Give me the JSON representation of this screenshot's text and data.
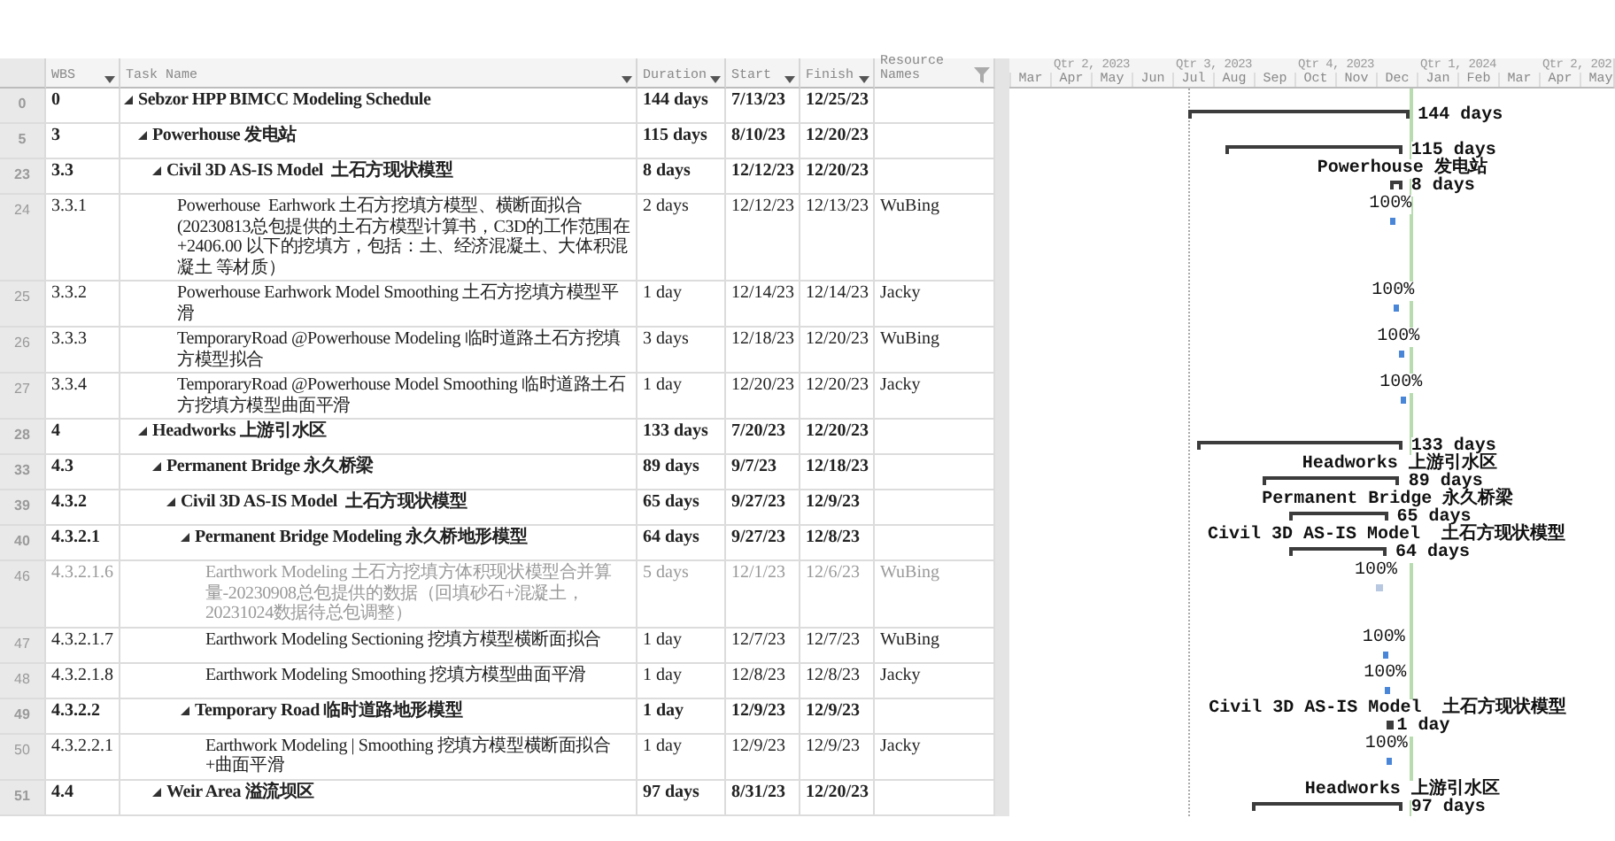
{
  "table": {
    "columns": [
      {
        "label": "WBS"
      },
      {
        "label": "Task Name"
      },
      {
        "label": "Duration"
      },
      {
        "label": "Start"
      },
      {
        "label": "Finish"
      },
      {
        "label": "Resource Names"
      }
    ],
    "rows": [
      {
        "id": "0",
        "wbs": "0",
        "name": "Sebzor HPP BIMCC Modeling Schedule",
        "duration": "144 days",
        "start": "7/13/23",
        "finish": "12/25/23",
        "kind": "summary",
        "expanded": true,
        "gantt": {
          "right": "144 days"
        },
        "children": [
          {
            "id": "5",
            "wbs": "3",
            "name": "Powerhouse 发电站",
            "duration": "115 days",
            "start": "8/10/23",
            "finish": "12/20/23",
            "kind": "summary",
            "expanded": true,
            "gantt": {
              "right": "115 days"
            },
            "children": [
              {
                "id": "23",
                "wbs": "3.3",
                "name": "Civil 3D AS-IS Model  土石方现状模型",
                "duration": "8 days",
                "start": "12/12/23",
                "finish": "12/20/23",
                "kind": "summary",
                "expanded": true,
                "gantt": {
                  "above": "Powerhouse 发电站",
                  "right": "8 days"
                },
                "children": [
                  {
                    "id": "24",
                    "wbs": "3.3.1",
                    "name": "Powerhouse  Earhwork 土石方挖填方模型、横断面拟合 (20230813总包提供的土石方模型计算书，C3D的工作范围在 +2406.00 以下的挖填方，包括：土、经济混凝土、大体积混凝土 等材质）",
                    "duration": "2 days",
                    "start": "12/12/23",
                    "finish": "12/13/23",
                    "resources": "WuBing",
                    "kind": "task",
                    "gantt": {
                      "above": "100%"
                    }
                  },
                  {
                    "id": "25",
                    "wbs": "3.3.2",
                    "name": "Powerhouse Earhwork Model Smoothing 土石方挖填方模型平滑",
                    "duration": "1 day",
                    "start": "12/14/23",
                    "finish": "12/14/23",
                    "resources": "Jacky",
                    "kind": "task",
                    "gantt": {
                      "above": "100%"
                    }
                  },
                  {
                    "id": "26",
                    "wbs": "3.3.3",
                    "name": "TemporaryRoad @Powerhouse Modeling 临时道路土石方挖填方模型拟合",
                    "duration": "3 days",
                    "start": "12/18/23",
                    "finish": "12/20/23",
                    "resources": "WuBing",
                    "kind": "task",
                    "gantt": {
                      "above": "100%"
                    }
                  },
                  {
                    "id": "27",
                    "wbs": "3.3.4",
                    "name": "TemporaryRoad @Powerhouse Model Smoothing 临时道路土石方挖填方模型曲面平滑",
                    "duration": "1 day",
                    "start": "12/20/23",
                    "finish": "12/20/23",
                    "resources": "Jacky",
                    "kind": "task",
                    "gantt": {
                      "above": "100%"
                    }
                  }
                ]
              }
            ]
          },
          {
            "id": "28",
            "wbs": "4",
            "name": "Headworks 上游引水区",
            "duration": "133 days",
            "start": "7/20/23",
            "finish": "12/20/23",
            "kind": "summary",
            "expanded": true,
            "gantt": {
              "right": "133 days"
            },
            "children": [
              {
                "id": "33",
                "wbs": "4.3",
                "name": "Permanent Bridge 永久桥梁",
                "duration": "89 days",
                "start": "9/7/23",
                "finish": "12/18/23",
                "kind": "summary",
                "expanded": true,
                "gantt": {
                  "above": "Headworks 上游引水区",
                  "right": "89 days"
                },
                "children": [
                  {
                    "id": "39",
                    "wbs": "4.3.2",
                    "name": "Civil 3D AS-IS Model  土石方现状模型",
                    "duration": "65 days",
                    "start": "9/27/23",
                    "finish": "12/9/23",
                    "kind": "summary",
                    "expanded": true,
                    "gantt": {
                      "above": "Permanent Bridge 永久桥梁",
                      "right": "65 days"
                    },
                    "children": [
                      {
                        "id": "40",
                        "wbs": "4.3.2.1",
                        "name": "Permanent Bridge Modeling 永久桥地形模型",
                        "duration": "64 days",
                        "start": "9/27/23",
                        "finish": "12/8/23",
                        "kind": "summary",
                        "expanded": true,
                        "gantt": {
                          "above": "Civil 3D AS-IS Model  土石方现状模型",
                          "right": "64 days"
                        },
                        "children": [
                          {
                            "id": "46",
                            "wbs": "4.3.2.1.6",
                            "name": "Earthwork Modeling 土石方挖填方体积现状模型合并算量-20230908总包提供的数据（回填砂石+混凝土，20231024数据待总包调整）",
                            "duration": "5 days",
                            "start": "12/1/23",
                            "finish": "12/6/23",
                            "resources": "WuBing",
                            "kind": "task",
                            "inactive": true,
                            "gantt": {
                              "above": "100%"
                            }
                          },
                          {
                            "id": "47",
                            "wbs": "4.3.2.1.7",
                            "name": "Earthwork Modeling Sectioning 挖填方模型横断面拟合",
                            "duration": "1 day",
                            "start": "12/7/23",
                            "finish": "12/7/23",
                            "resources": "WuBing",
                            "kind": "task",
                            "gantt": {
                              "above": "100%"
                            }
                          },
                          {
                            "id": "48",
                            "wbs": "4.3.2.1.8",
                            "name": "Earthwork Modeling Smoothing 挖填方模型曲面平滑",
                            "duration": "1 day",
                            "start": "12/8/23",
                            "finish": "12/8/23",
                            "resources": "Jacky",
                            "kind": "task",
                            "gantt": {
                              "above": "100%"
                            }
                          }
                        ]
                      },
                      {
                        "id": "49",
                        "wbs": "4.3.2.2",
                        "name": "Temporary Road 临时道路地形模型",
                        "duration": "1 day",
                        "start": "12/9/23",
                        "finish": "12/9/23",
                        "kind": "summary",
                        "expanded": true,
                        "gantt": {
                          "above": "Civil 3D AS-IS Model  土石方现状模型",
                          "right": "1 day"
                        },
                        "children": [
                          {
                            "id": "50",
                            "wbs": "4.3.2.2.1",
                            "name": "Earthwork Modeling | Smoothing 挖填方模型横断面拟合+曲面平滑",
                            "duration": "1 day",
                            "start": "12/9/23",
                            "finish": "12/9/23",
                            "resources": "Jacky",
                            "kind": "task",
                            "gantt": {
                              "above": "100%"
                            }
                          }
                        ]
                      }
                    ]
                  }
                ]
              },
              {
                "id": "51",
                "wbs": "4.4",
                "name": "Weir Area 溢流坝区",
                "duration": "97 days",
                "start": "8/31/23",
                "finish": "12/20/23",
                "kind": "summary",
                "expanded": true,
                "gantt": {
                  "above": "Headworks 上游引水区",
                  "right": "97 days"
                }
              }
            ]
          }
        ]
      }
    ]
  },
  "timescale": {
    "quarters": [
      {
        "label": "Qtr 2, 2023"
      },
      {
        "label": "Qtr 3, 2023"
      },
      {
        "label": "Qtr 4, 2023"
      },
      {
        "label": "Qtr 1, 2024"
      },
      {
        "label": "Qtr 2, 202"
      }
    ],
    "months": [
      "Mar",
      "Apr",
      "May",
      "Jun",
      "Jul",
      "Aug",
      "Sep",
      "Oct",
      "Nov",
      "Dec",
      "Jan",
      "Feb",
      "Mar",
      "Apr",
      "May"
    ]
  }
}
